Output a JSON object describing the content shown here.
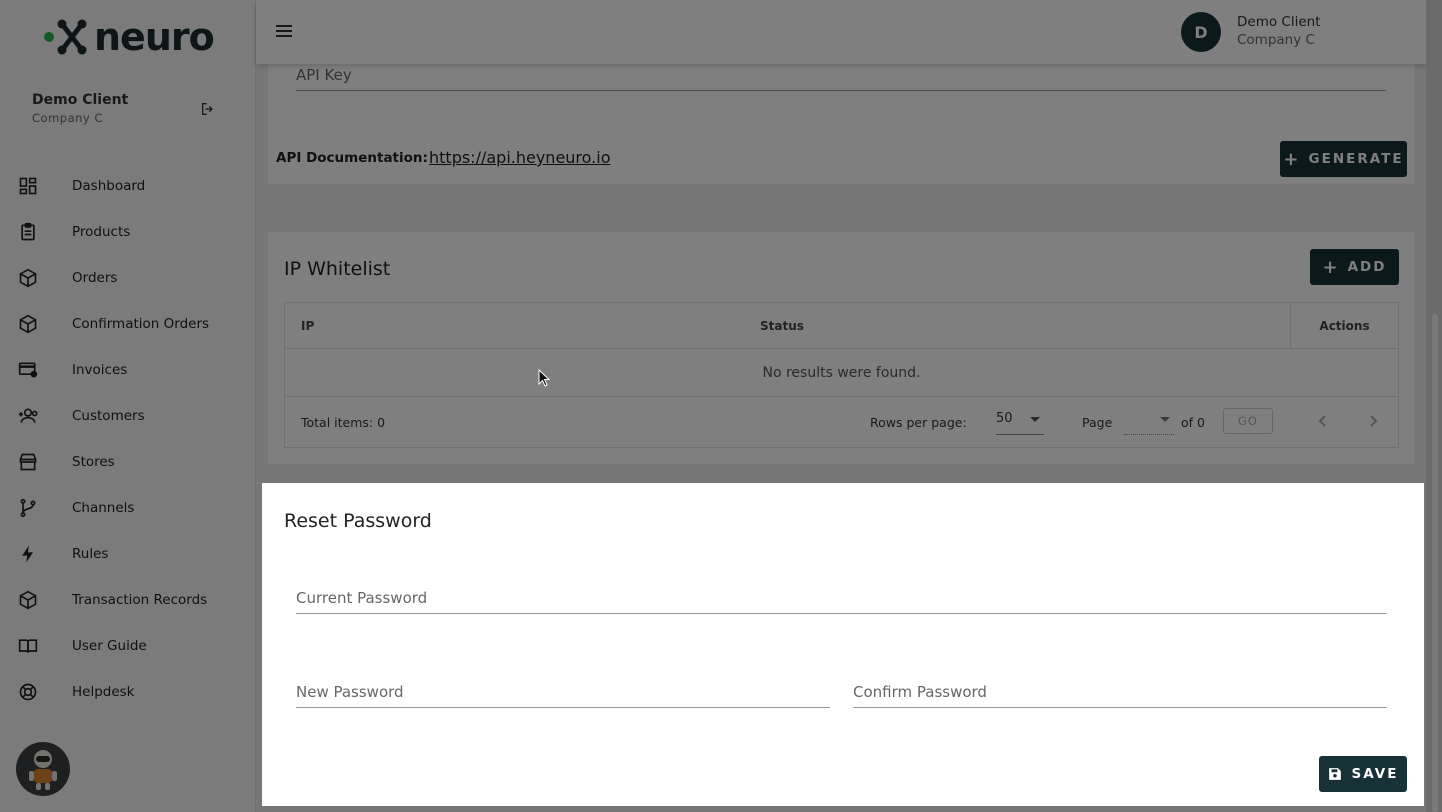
{
  "brand": {
    "name": "neuro",
    "accent": "#2bb24c",
    "dark": "#163236"
  },
  "sidebar": {
    "user_name": "Demo Client",
    "user_company": "Company C",
    "items": [
      {
        "label": "Dashboard",
        "icon": "dashboard-icon"
      },
      {
        "label": "Products",
        "icon": "clipboard-icon"
      },
      {
        "label": "Orders",
        "icon": "box-icon"
      },
      {
        "label": "Confirmation Orders",
        "icon": "box-icon"
      },
      {
        "label": "Invoices",
        "icon": "card-location-icon"
      },
      {
        "label": "Customers",
        "icon": "add-user-icon"
      },
      {
        "label": "Stores",
        "icon": "store-icon"
      },
      {
        "label": "Channels",
        "icon": "branch-icon"
      },
      {
        "label": "Rules",
        "icon": "bolt-icon"
      },
      {
        "label": "Transaction Records",
        "icon": "box-icon"
      },
      {
        "label": "User Guide",
        "icon": "book-icon"
      },
      {
        "label": "Helpdesk",
        "icon": "lifebuoy-icon"
      }
    ]
  },
  "topbar": {
    "avatar_letter": "D",
    "user_name": "Demo Client",
    "user_company": "Company C"
  },
  "api": {
    "key_placeholder": "API Key",
    "doc_label": "API Documentation:",
    "doc_link": "https://api.heyneuro.io",
    "generate_label": "GENERATE"
  },
  "ip_whitelist": {
    "title": "IP Whitelist",
    "add_label": "ADD",
    "columns": [
      "IP",
      "Status",
      "Actions"
    ],
    "empty_text": "No results were found.",
    "total_label": "Total items: 0",
    "rows_per_page_label": "Rows per page:",
    "rows_per_page_value": "50",
    "page_label": "Page",
    "of_label": "of 0",
    "go_label": "GO"
  },
  "reset_password": {
    "title": "Reset Password",
    "current_placeholder": "Current Password",
    "new_placeholder": "New Password",
    "confirm_placeholder": "Confirm Password",
    "save_label": "SAVE"
  }
}
